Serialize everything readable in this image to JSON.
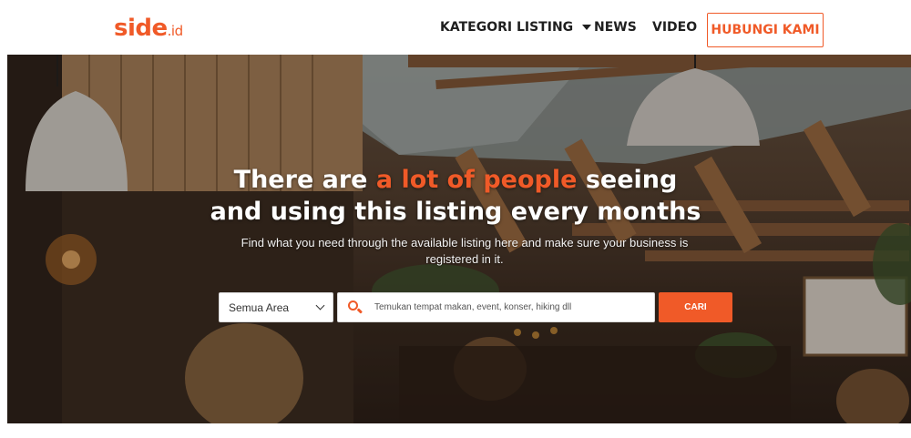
{
  "brand": {
    "name": "side",
    "tld": ".id",
    "color": "#f05a28"
  },
  "nav": {
    "category": "KATEGORI LISTING",
    "news": "NEWS",
    "video": "VIDEO",
    "contact": "HUBUNGI KAMI"
  },
  "hero": {
    "line1_before": "There are ",
    "line1_accent": "a lot of people",
    "line1_after": " seeing",
    "line2": "and using this listing every months",
    "subtitle": "Find what you need through the available listing here and make sure your business is registered in it."
  },
  "search": {
    "area_selected": "Semua Area",
    "placeholder": "Temukan tempat makan, event, konser, hiking dll",
    "button": "CARI"
  },
  "icons": {
    "search": "search-icon",
    "dropdown": "chevron-down-icon",
    "menu_caret": "caret-down-icon"
  }
}
